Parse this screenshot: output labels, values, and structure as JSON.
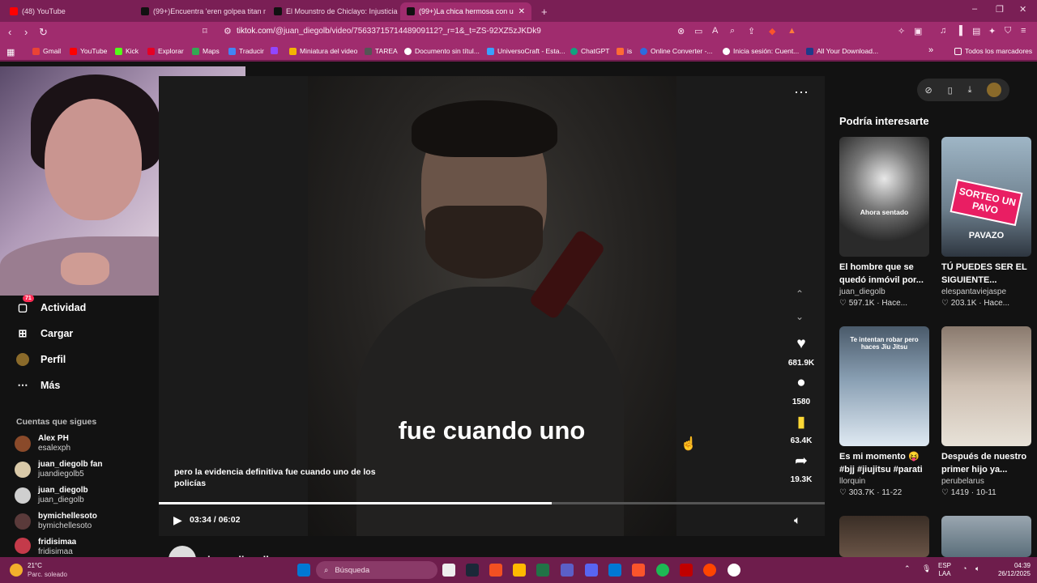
{
  "browser": {
    "tabs": [
      {
        "label": "(48) YouTube",
        "color": "#ff0000"
      },
      {
        "label": "(99+)Encuentra 'eren golpea titan m",
        "color": "#111111"
      },
      {
        "label": "El Mounstro de Chiclayo: Injusticia e",
        "color": "#111111"
      },
      {
        "label": "(99+)La chica hermosa con u",
        "color": "#111111",
        "active": true
      }
    ],
    "new_tab": "+",
    "window_controls": {
      "minimize": "–",
      "maximize": "❐",
      "close": "✕"
    },
    "url_host": "tiktok.com",
    "url_path": "/@juan_diegolb/video/7563371571448909112?_r=1&_t=ZS-92XZ5zJKDk9",
    "bookmarks": [
      {
        "label": "Gmail",
        "color": "#ea4335"
      },
      {
        "label": "YouTube",
        "color": "#ff0000"
      },
      {
        "label": "Kick",
        "color": "#53fc18"
      },
      {
        "label": "Explorar",
        "color": "#e60023"
      },
      {
        "label": "Maps",
        "color": "#34a853"
      },
      {
        "label": "Traducir",
        "color": "#4285f4"
      },
      {
        "label": "",
        "color": "#9146ff"
      },
      {
        "label": "Miniatura del video",
        "color": "#f4b400"
      },
      {
        "label": "TAREA",
        "color": "#555555"
      },
      {
        "label": "Documento sin títul...",
        "color": "#ffffff"
      },
      {
        "label": "UniversoCraft - Esta...",
        "color": "#3aa0ff"
      },
      {
        "label": "ChatGPT",
        "color": "#10a37f"
      },
      {
        "label": "is",
        "color": "#ff6b35"
      },
      {
        "label": "Online Converter -...",
        "color": "#2d6cdf"
      },
      {
        "label": "Inicia sesión: Cuent...",
        "color": "#ffffff"
      },
      {
        "label": "All Your Download...",
        "color": "#1e3a8a"
      }
    ],
    "bookmarks_more": "»",
    "all_bookmarks": "Todos los marcadores"
  },
  "sidebar": {
    "items": [
      {
        "label": "Actividad",
        "icon": "inbox-icon",
        "badge": "71"
      },
      {
        "label": "Cargar",
        "icon": "plus-square-icon"
      },
      {
        "label": "Perfil",
        "icon": "avatar"
      },
      {
        "label": "Más",
        "icon": "more-icon"
      }
    ],
    "following_title": "Cuentas que sigues",
    "following": [
      {
        "name": "Alex PH",
        "user": "esalexph",
        "color": "#8a4a2a"
      },
      {
        "name": "juan_diegolb fan",
        "user": "juandiegolb5",
        "color": "#d9c9a8"
      },
      {
        "name": "juan_diegolb",
        "user": "juan_diegolb",
        "color": "#cfcfcf"
      },
      {
        "name": "bymichellesoto",
        "user": "bymichellesoto",
        "color": "#5a3a3a"
      },
      {
        "name": "fridisimaa",
        "user": "fridisimaa",
        "color": "#c43a4a"
      }
    ]
  },
  "video": {
    "caption_big": "fue cuando uno",
    "caption_small": "pero la evidencia definitiva fue cuando uno de los policías",
    "likes": "681.9K",
    "comments": "1580",
    "saves": "63.4K",
    "shares": "19.3K",
    "time": "03:34 / 06:02",
    "progress": 0.59,
    "author": "juan_diegolb"
  },
  "recommended": {
    "title": "Podría interesarte",
    "cards": [
      {
        "overlay": "Ahora sentado",
        "title": "El hombre que se quedó inmóvil por...",
        "user": "juan_diegolb",
        "meta": "♡ 597.1K · Hace...",
        "bg": "#3d3d3d"
      },
      {
        "overlay": "SORTEO UN PAVO",
        "overlay2": "PAVAZO",
        "title": "TÚ PUEDES SER EL SIGUIENTE...",
        "user": "elespantaviejaspe",
        "meta": "♡ 203.1K · Hace...",
        "bg": "#8aa6b8"
      },
      {
        "overlay": "Te intentan robar pero haces Jiu Jitsu",
        "title": "Es mi momento 😝 #bjj #jiujitsu #parati",
        "user": "llorquin",
        "meta": "♡ 303.7K · 11-22",
        "bg": "#6e8aa6"
      },
      {
        "overlay": "",
        "title": "Después de nuestro primer hijo ya...",
        "user": "perubelarus",
        "meta": "♡ 1419 · 10-11",
        "bg": "#b8a89a"
      }
    ]
  },
  "taskbar": {
    "temp": "21°C",
    "weather": "Parc. soleado",
    "search": "Búsqueda",
    "lang1": "ESP",
    "lang2": "LAA",
    "clock_time": "04:39",
    "clock_date": "26/12/2025",
    "apps": [
      "#0078d4",
      "#eeeeee",
      "#1b2838",
      "#f25022",
      "#ffb900",
      "#217346",
      "#5b5fc7",
      "#5865f2",
      "#0078d4",
      "#fb542b",
      "#1db954",
      "#c00000",
      "#ff4500",
      "#ffffff"
    ]
  }
}
